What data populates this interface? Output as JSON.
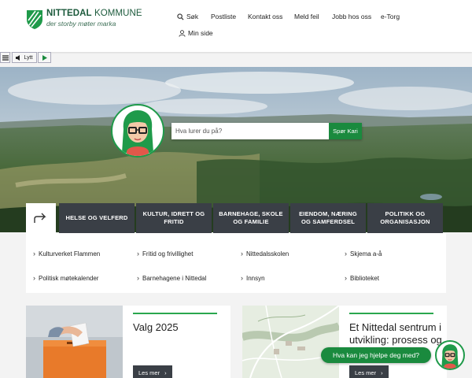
{
  "header": {
    "logo_name_bold": "NITTEDAL",
    "logo_name_rest": " KOMMUNE",
    "logo_tagline": "der storby møter marka",
    "nav": [
      {
        "label": "Søk",
        "icon": "search-icon"
      },
      {
        "label": "Postliste"
      },
      {
        "label": "Kontakt oss"
      },
      {
        "label": "Meld feil"
      },
      {
        "label": "Jobb hos oss"
      },
      {
        "label": "e-Torg"
      },
      {
        "label": "Min side",
        "icon": "user-icon"
      }
    ],
    "brand_color": "#1f9a4a"
  },
  "listen_bar": {
    "play_label": "Lytt"
  },
  "search": {
    "placeholder": "Hva lurer du på?",
    "button_label": "Spør Kari"
  },
  "categories": [
    "HELSE OG VELFERD",
    "KULTUR, IDRETT OG FRITID",
    "BARNEHAGE, SKOLE OG FAMILIE",
    "EIENDOM, NÆRING OG SAMFERDSEL",
    "POLITIKK OG ORGANISASJON"
  ],
  "quick_links": [
    "Kulturverket Flammen",
    "Fritid og frivillighet",
    "Nittedalsskolen",
    "Skjema a-å",
    "Politisk møtekalender",
    "Barnehagene i Nittedal",
    "Innsyn",
    "Biblioteket"
  ],
  "cards": [
    {
      "title": "Valg 2025",
      "button": "Les mer"
    },
    {
      "title": "Et Nittedal sentrum i utvikling: prosess og",
      "button": "Les mer"
    }
  ],
  "chat": {
    "prompt": "Hva kan jeg hjelpe deg med?"
  },
  "colors": {
    "accent_green": "#1a8a3e",
    "tile_dark": "#3a3f46"
  }
}
